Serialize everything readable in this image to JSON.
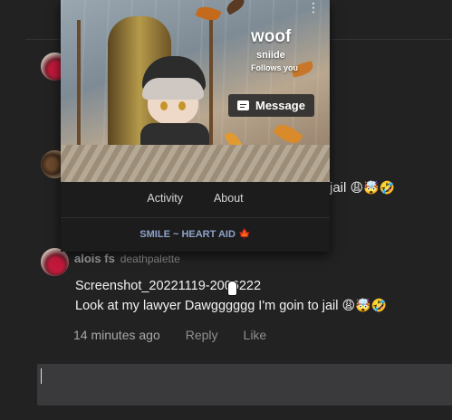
{
  "popup": {
    "profile_name": "woof",
    "profile_handle": "sniide",
    "follows_label": "Follows you",
    "message_button": "Message",
    "tabs": [
      "Activity",
      "About"
    ],
    "tagline": "SMILE ~ HEART AID",
    "tagline_emoji": "🍁"
  },
  "background_comment": {
    "text_fragment": "jail",
    "emojis": "😩🤯🤣"
  },
  "comment": {
    "author": "alois fs",
    "handle": "deathpalette",
    "line1": "Screenshot_20221119-2006222",
    "line2_text": "Look at my lawyer Dawgggggg I'm goin to jail",
    "line2_emojis": "😩🤯🤣",
    "time": "14 minutes ago",
    "reply_label": "Reply",
    "like_label": "Like"
  },
  "reply_input": {
    "value": ""
  },
  "colors": {
    "background": "#222223",
    "input_bg": "#3a3a3c",
    "tagline": "#8ea2c8",
    "popup_bg": "#1c1c1d"
  }
}
